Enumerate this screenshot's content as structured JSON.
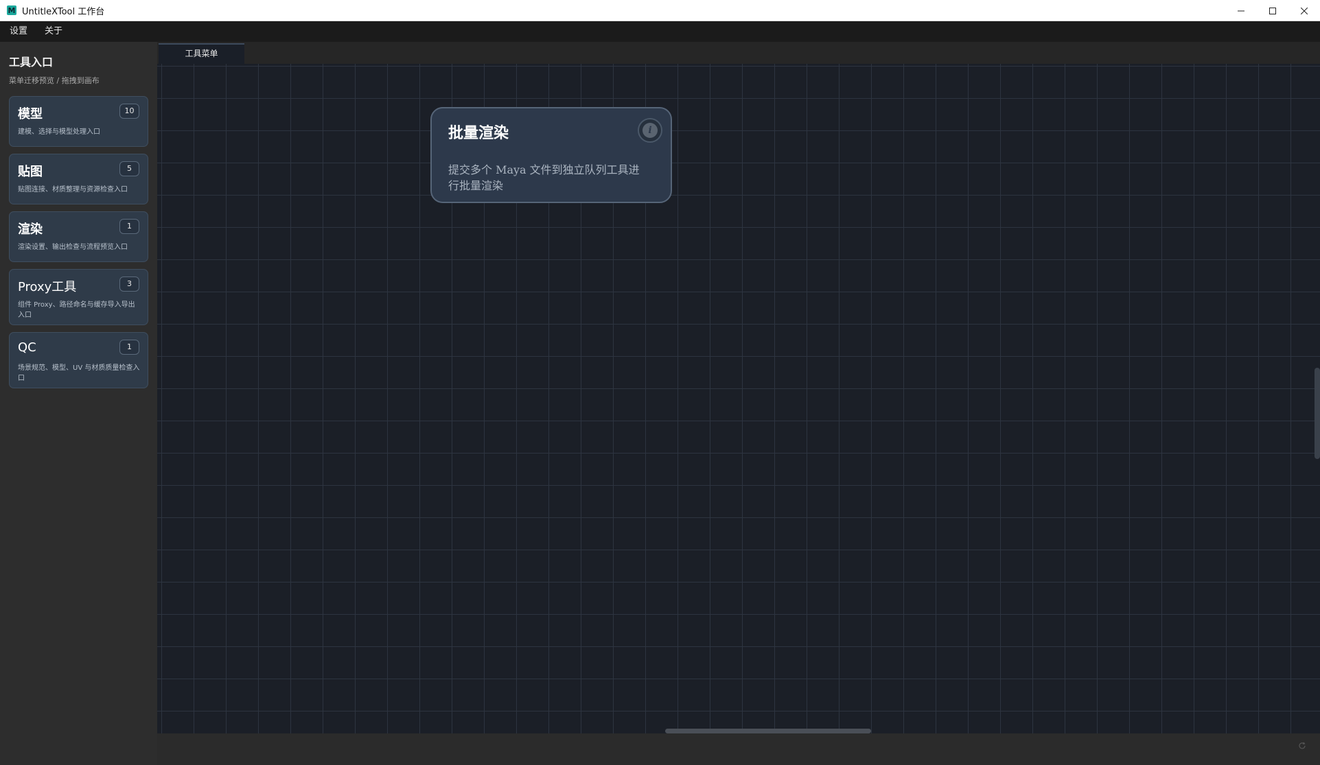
{
  "window": {
    "title": "UntitleXTool 工作台",
    "icon_letter": "M",
    "controls": [
      "minimize-icon",
      "maximize-icon",
      "close-icon"
    ]
  },
  "menu": {
    "items": [
      "设置",
      "关于"
    ]
  },
  "sidebar": {
    "title": "工具入口",
    "subtitle": "菜单迁移预览 / 拖拽到画布",
    "categories": [
      {
        "title": "模型",
        "count": "10",
        "desc": "建模、选择与模型处理入口"
      },
      {
        "title": "贴图",
        "count": "5",
        "desc": "贴图连接、材质整理与资源检查入口"
      },
      {
        "title": "渲染",
        "count": "1",
        "desc": "渲染设置、输出检查与流程预览入口"
      },
      {
        "title": "Proxy工具",
        "count": "3",
        "desc": "组件 Proxy、路径命名与缓存导入导出入口"
      },
      {
        "title": "QC",
        "count": "1",
        "desc": "场景规范、模型、UV 与材质质量检查入口"
      }
    ]
  },
  "tabs": [
    {
      "label": "工具菜单",
      "active": true
    }
  ],
  "canvas": {
    "node": {
      "title": "批量渲染",
      "info_glyph": "i",
      "desc": "提交多个 Maya 文件到独立队列工具进行批量渲染"
    }
  },
  "colors": {
    "canvas_bg": "#1b1f27",
    "grid_line": "#2d3440",
    "card_bg": "#2f3b49",
    "node_bg": "#2d394b",
    "accent": "#1aa89c"
  }
}
